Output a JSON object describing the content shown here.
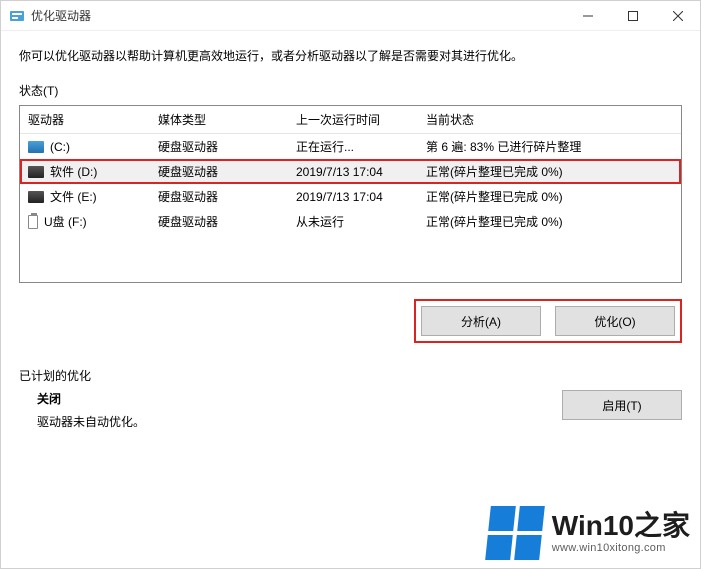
{
  "window": {
    "title": "优化驱动器"
  },
  "description": "你可以优化驱动器以帮助计算机更高效地运行，或者分析驱动器以了解是否需要对其进行优化。",
  "status_label": "状态(T)",
  "columns": {
    "drive": "驱动器",
    "media": "媒体类型",
    "last_run": "上一次运行时间",
    "current_state": "当前状态"
  },
  "rows": [
    {
      "icon": "ssd",
      "drive": "(C:)",
      "media": "硬盘驱动器",
      "last_run": "正在运行...",
      "state": "第 6 遍: 83% 已进行碎片整理",
      "selected": false,
      "highlight": false
    },
    {
      "icon": "hdd",
      "drive": "软件 (D:)",
      "media": "硬盘驱动器",
      "last_run": "2019/7/13 17:04",
      "state": "正常(碎片整理已完成 0%)",
      "selected": true,
      "highlight": true
    },
    {
      "icon": "hdd",
      "drive": "文件 (E:)",
      "media": "硬盘驱动器",
      "last_run": "2019/7/13 17:04",
      "state": "正常(碎片整理已完成 0%)",
      "selected": false,
      "highlight": false
    },
    {
      "icon": "usb",
      "drive": "U盘 (F:)",
      "media": "硬盘驱动器",
      "last_run": "从未运行",
      "state": "正常(碎片整理已完成 0%)",
      "selected": false,
      "highlight": false
    }
  ],
  "buttons": {
    "analyze": "分析(A)",
    "optimize": "优化(O)",
    "enable": "启用(T)"
  },
  "schedule": {
    "heading": "已计划的优化",
    "status_title": "关闭",
    "status_desc": "驱动器未自动优化。"
  },
  "watermark": {
    "title": "Win10之家",
    "url": "www.win10xitong.com"
  }
}
